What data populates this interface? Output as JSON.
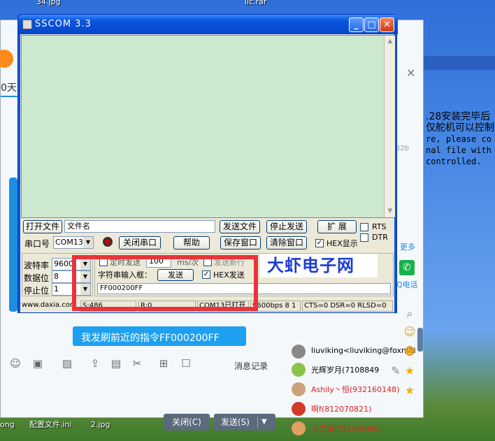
{
  "desktop": {
    "labels": [
      "34.jpg",
      "lic.rar",
      "ong",
      "配置文件.ini",
      "2.jpg"
    ]
  },
  "chat": {
    "day_label": "0天",
    "message_bubble": "我发刷前近的指令FF000200FF",
    "message_record": "消息记录",
    "close_button": "关闭(C)",
    "send_button": "发送(S)",
    "more_label": "更多",
    "phone_label": "Q电话",
    "right_panel_lines": [
      ".28安装完毕后",
      "仅舵机可以控制",
      "",
      "re, please co",
      "nal file with",
      "controlled."
    ],
    "grey_number": "52b",
    "contacts": [
      {
        "name": "liuviking<liuviking@foxmai",
        "color": "#333333"
      },
      {
        "name": "光辉岁月(7108849",
        "color": "#333333"
      },
      {
        "name": "Ashily丶恒(932160148)",
        "color": "#e02020"
      },
      {
        "name": "啊f(812070821)",
        "color": "#e02020"
      },
      {
        "name": "大力鼠(75163366)",
        "color": "#e02020"
      }
    ]
  },
  "sscom": {
    "title": "SSCOM 3.3",
    "open_file": "打开文件",
    "filename_value": "文件名",
    "send_file": "发送文件",
    "stop_send": "停止发送",
    "expand": "扩 展",
    "rts": "RTS",
    "dtr": "DTR",
    "port_label": "串口号",
    "port_value": "COM13",
    "close_port": "关闭串口",
    "help": "帮助",
    "save_window": "保存窗口",
    "clear_window": "清除窗口",
    "hex_display": "HEX显示",
    "baud_label": "波特率",
    "baud_value": "9600",
    "databits_label": "数据位",
    "databits_value": "8",
    "stopbits_label": "停止位",
    "stopbits_value": "1",
    "timed_send": "定时发送",
    "timed_value": "100",
    "timed_unit": "ms/次",
    "send_newline": "发送新行",
    "string_input_label": "字符串输入框：",
    "send_button": "发送",
    "hex_send": "HEX发送",
    "input_value": "FF000200FF",
    "status": {
      "website": "www.daxia.com",
      "sent": "S:486",
      "received": "R:0",
      "port_state": "COM13已打开",
      "settings": "9600bps  8 1",
      "lines": "CTS=0 DSR=0 RLSD=0"
    }
  },
  "brand": "大虾电子网",
  "colors": {
    "receive_bg": "#cce8cf",
    "annotation_red": "#e8343a",
    "brand_blue": "#1c3cd6"
  }
}
